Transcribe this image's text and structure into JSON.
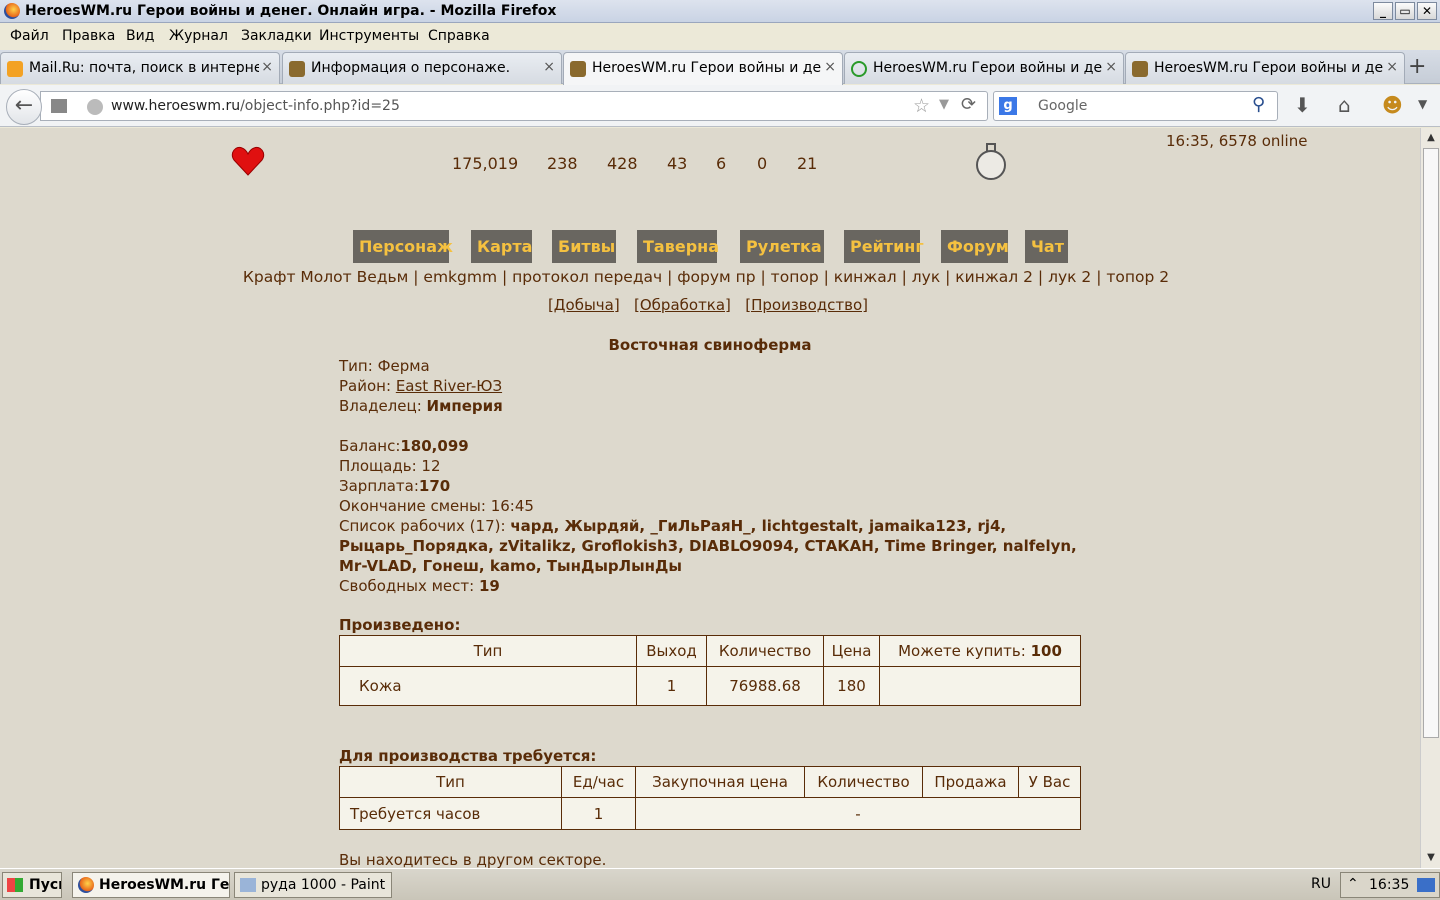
{
  "window": {
    "title": "HeroesWM.ru Герои войны и денег. Онлайн игра. - Mozilla Firefox",
    "btn_min": "_",
    "btn_max": "▭",
    "btn_close": "✕"
  },
  "menu": [
    "Файл",
    "Правка",
    "Вид",
    "Журнал",
    "Закладки",
    "Инструменты",
    "Справка"
  ],
  "tabs": [
    {
      "label": "Mail.Ru: почта, поиск в интернет...",
      "icon": "mail-icon"
    },
    {
      "label": "Информация о персонаже.",
      "icon": "helmet-icon"
    },
    {
      "label": "HeroesWM.ru Герои войны и дене...",
      "icon": "helmet-icon"
    },
    {
      "label": "HeroesWM.ru Герои войны и дене...",
      "icon": "loading-icon"
    },
    {
      "label": "HeroesWM.ru Герои войны и дене...",
      "icon": "helmet-icon"
    }
  ],
  "tab_close": "×",
  "new_tab": "+",
  "url": {
    "host": "www.heroeswm.ru",
    "path": "/object-info.php?id=25"
  },
  "search": {
    "engine": "g",
    "placeholder": "Google"
  },
  "header": {
    "time_online": "16:35, 6578 online",
    "stats": [
      "175,019",
      "238",
      "428",
      "43",
      "6",
      "0",
      "21"
    ]
  },
  "nav_buttons": [
    "Персонаж",
    "Карта",
    "Битвы",
    "Таверна",
    "Рулетка",
    "Рейтинг",
    "Форум",
    "Чат"
  ],
  "quick_links": "Крафт Молот Ведьм | emkgmm | протокол передач | форум пр | топор | кинжал | лук | кинжал 2 | лук 2 | топор 2",
  "sub_links": [
    "[Добыча]",
    "[Обработка]",
    "[Производство]"
  ],
  "object": {
    "title": "Восточная свиноферма",
    "type_label": "Тип:",
    "type": "Ферма",
    "district_label": "Район:",
    "district": "East River-ЮЗ",
    "owner_label": "Владелец:",
    "owner": "Империя",
    "balance_label": "Баланс:",
    "balance": "180,099",
    "area_label": "Площадь:",
    "area": "12",
    "salary_label": "Зарплата:",
    "salary": "170",
    "shift_end": "Окончание смены: 16:45",
    "workers_label": "Список рабочих (17):",
    "workers_line1": "чард, Жырдяй, _ГиЛьРаяН_, lichtgestalt, jamaika123, rj4,",
    "workers_line2": "Рыцарь_Порядка, zVitalikz, Groflokish3, DIABLO9094, СТАКАН, Time Bringer, nalfelyn,",
    "workers_line3": "Mr-VLAD, Гонеш, kamo, ТынДырЛынДы",
    "free_label": "Свободных мест:",
    "free": "19"
  },
  "produced": {
    "title": "Произведено:",
    "headers": [
      "Тип",
      "Выход",
      "Количество",
      "Цена",
      "Можете купить:"
    ],
    "can_buy": "100",
    "row": [
      "Кожа",
      "1",
      "76988.68",
      "180",
      ""
    ]
  },
  "required": {
    "title": "Для производства требуется:",
    "headers": [
      "Тип",
      "Ед/час",
      "Закупочная цена",
      "Количество",
      "Продажа",
      "У Вас"
    ],
    "row": [
      "Требуется часов",
      "1",
      "-"
    ]
  },
  "footer_note": "Вы находитесь в другом секторе.",
  "taskbar": {
    "start": "Пуск",
    "items": [
      "HeroesWM.ru Ге...",
      "руда 1000 - Paint"
    ],
    "lang": "RU",
    "clock": "16:35"
  }
}
